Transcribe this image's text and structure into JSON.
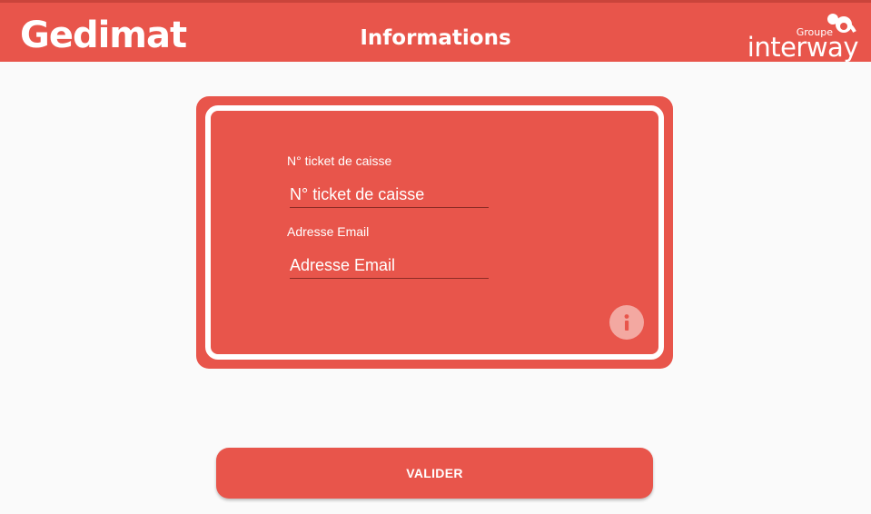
{
  "colors": {
    "primary": "#e8554b",
    "header_border": "#c9443b",
    "info_circle": "#f3a8a1",
    "background": "#fafafa"
  },
  "header": {
    "brand": "Gedimat",
    "title": "Informations",
    "partner_prefix": "Groupe",
    "partner_name": "interway"
  },
  "form": {
    "ticket": {
      "label": "N° ticket de caisse",
      "placeholder": "N° ticket de caisse",
      "value": ""
    },
    "email": {
      "label": "Adresse Email",
      "placeholder": "Adresse Email",
      "value": ""
    },
    "info_icon": "info-icon"
  },
  "actions": {
    "validate_label": "VALIDER"
  }
}
